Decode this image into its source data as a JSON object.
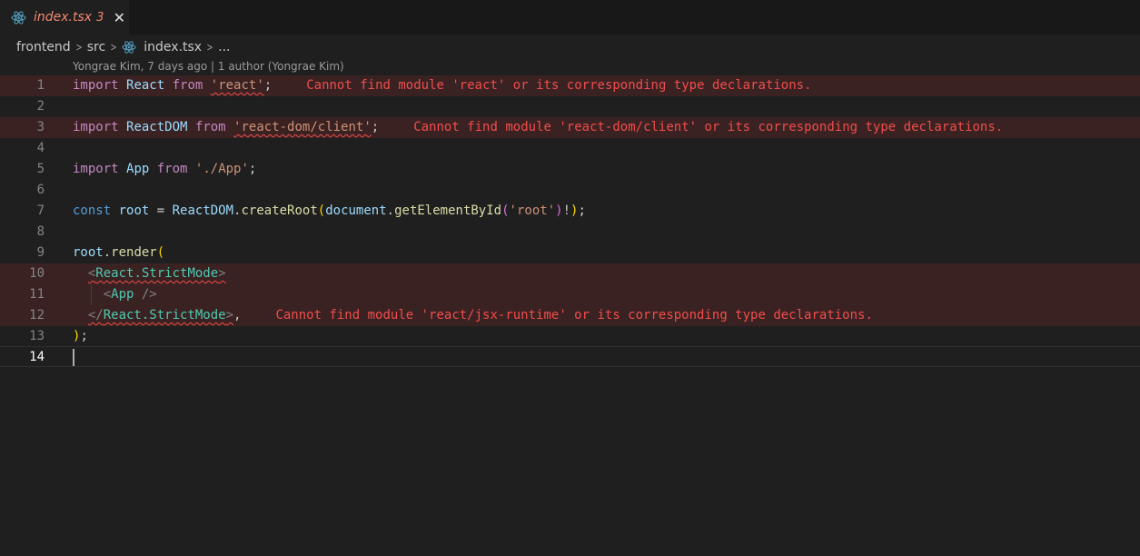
{
  "tab": {
    "file": "index.tsx",
    "problem_count": "3",
    "close": "✕"
  },
  "breadcrumb": {
    "folder1": "frontend",
    "folder2": "src",
    "file": "index.tsx",
    "more": "..."
  },
  "codelens": "Yongrae Kim, 7 days ago | 1 author (Yongrae Kim)",
  "lines": {
    "l1": {
      "n": "1",
      "import": "import",
      "name": "React",
      "from": "from",
      "src": "'react'",
      "semi": ";",
      "error": "Cannot find module 'react' or its corresponding type declarations."
    },
    "l2": {
      "n": "2"
    },
    "l3": {
      "n": "3",
      "import": "import",
      "name": "ReactDOM",
      "from": "from",
      "src": "'react-dom/client'",
      "semi": ";",
      "error": "Cannot find module 'react-dom/client' or its corresponding type declarations."
    },
    "l4": {
      "n": "4"
    },
    "l5": {
      "n": "5",
      "import": "import",
      "name": "App",
      "from": "from",
      "src": "'./App'",
      "semi": ";"
    },
    "l6": {
      "n": "6"
    },
    "l7": {
      "n": "7",
      "const": "const",
      "var": "root",
      "eq": " = ",
      "obj": "ReactDOM",
      "dot": ".",
      "method": "createRoot",
      "p1": "(",
      "doc": "document",
      "dot2": ".",
      "get": "getElementById",
      "p2": "(",
      "arg": "'root'",
      "p2c": ")",
      "bang": "!",
      "p1c": ")",
      "semi": ";"
    },
    "l8": {
      "n": "8"
    },
    "l9": {
      "n": "9",
      "var": "root",
      "dot": ".",
      "method": "render",
      "paren": "("
    },
    "l10": {
      "n": "10",
      "lt": "<",
      "tag": "React.StrictMode",
      "gt": ">"
    },
    "l11": {
      "n": "11",
      "lt": "<",
      "tag": "App",
      "close": " />"
    },
    "l12": {
      "n": "12",
      "lt": "</",
      "tag": "React.StrictMode",
      "gt": ">",
      "comma": ",",
      "error": "Cannot find module 'react/jsx-runtime' or its corresponding type declarations."
    },
    "l13": {
      "n": "13",
      "paren": ")",
      "semi": ";"
    },
    "l14": {
      "n": "14"
    }
  },
  "colors": {
    "error": "#f14c4c",
    "keyword": "#c586c0",
    "string": "#ce9178",
    "variable": "#9cdcfe",
    "function": "#dcdcaa",
    "tag": "#4ec9b0"
  },
  "icons": {
    "file_icon": "react-icon"
  }
}
